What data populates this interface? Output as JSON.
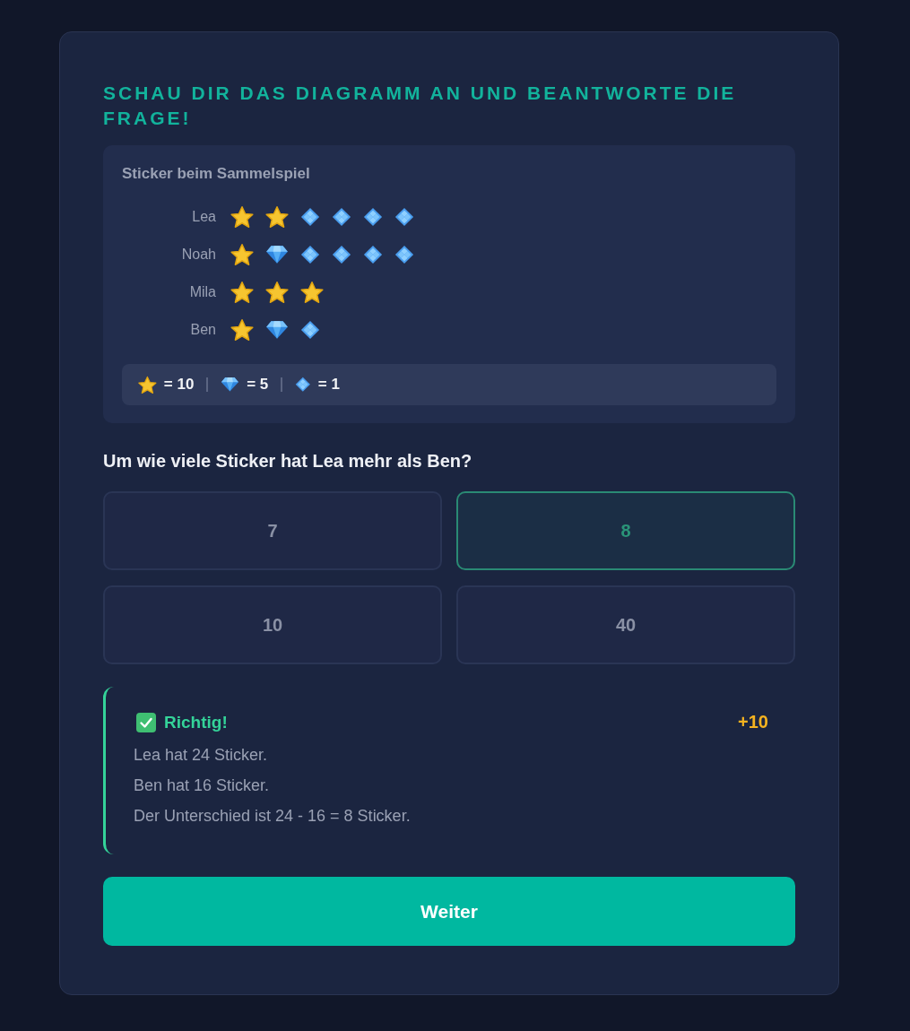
{
  "title": "SCHAU DIR DAS DIAGRAMM AN UND BEANTWORTE DIE FRAGE!",
  "chart": {
    "title": "Sticker beim Sammelspiel",
    "rows": [
      {
        "name": "Lea",
        "symbols": [
          {
            "kind": "star"
          },
          {
            "kind": "star"
          },
          {
            "kind": "diamond"
          },
          {
            "kind": "diamond"
          },
          {
            "kind": "diamond"
          },
          {
            "kind": "diamond"
          }
        ]
      },
      {
        "name": "Noah",
        "symbols": [
          {
            "kind": "star"
          },
          {
            "kind": "gem"
          },
          {
            "kind": "diamond"
          },
          {
            "kind": "diamond"
          },
          {
            "kind": "diamond"
          },
          {
            "kind": "diamond"
          }
        ]
      },
      {
        "name": "Mila",
        "symbols": [
          {
            "kind": "star"
          },
          {
            "kind": "star"
          },
          {
            "kind": "star"
          }
        ]
      },
      {
        "name": "Ben",
        "symbols": [
          {
            "kind": "star"
          },
          {
            "kind": "gem"
          },
          {
            "kind": "diamond"
          }
        ]
      }
    ],
    "legend": [
      {
        "kind": "star",
        "value": "= 10"
      },
      {
        "kind": "gem",
        "value": "= 5"
      },
      {
        "kind": "diamond",
        "value": "= 1"
      }
    ]
  },
  "question": "Um wie viele Sticker hat Lea mehr als Ben?",
  "options": [
    {
      "label": "7",
      "selected": false
    },
    {
      "label": "8",
      "selected": true
    },
    {
      "label": "10",
      "selected": false
    },
    {
      "label": "40",
      "selected": false
    }
  ],
  "feedback": {
    "kind": "correct",
    "title": "Richtig!",
    "points": "+10",
    "lines": [
      "Lea hat 24 Sticker.",
      "Ben hat 16 Sticker.",
      "Der Unterschied ist 24 - 16 = 8 Sticker."
    ]
  },
  "next_button": "Weiter"
}
